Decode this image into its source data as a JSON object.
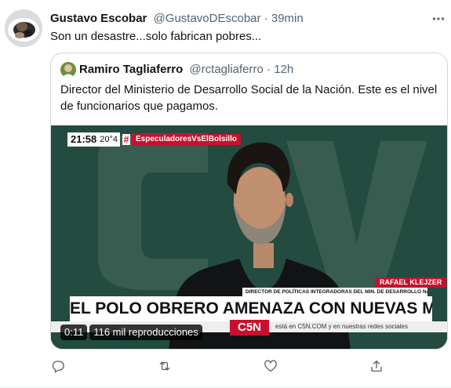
{
  "tweet": {
    "author_name": "Gustavo Escobar",
    "handle": "@GustavoDEscobar",
    "separator": "·",
    "time": "39min",
    "text": "Son un desastre...solo fabrican pobres..."
  },
  "quoted": {
    "author_name": "Ramiro Tagliaferro",
    "handle": "@rctagliaferro",
    "separator": "·",
    "time": "12h",
    "text": "Director del Ministerio de Desarrollo Social de la Nación. Este es el nivel de funcionarios que pagamos."
  },
  "video": {
    "clock": "21:58",
    "temperature": "20°4",
    "hashtag_symbol": "#",
    "hashtag": "EspeculadoresVsElBolsillo",
    "name_tag": "RAFAEL KLEJZER",
    "role_tag": "DIRECTOR DE POLÍTICAS INTEGRADORAS DEL MIN. DE DESARROLLO NACIONAL",
    "headline": "EL POLO OBRERO AMENAZA CON NUEVAS MEDIDAS",
    "ticker": "está en C5N.COM y en nuestras redes sociales",
    "channel_logo": "C5N",
    "duration": "0:11",
    "views": "116 mil reproducciones"
  },
  "icons": {
    "more": "more-icon",
    "reply": "reply-icon",
    "retweet": "retweet-icon",
    "like": "like-icon",
    "share": "share-icon"
  },
  "colors": {
    "text_primary": "#0f1419",
    "text_secondary": "#536471",
    "border": "#cfd9de",
    "c5n_red": "#c8102e"
  }
}
